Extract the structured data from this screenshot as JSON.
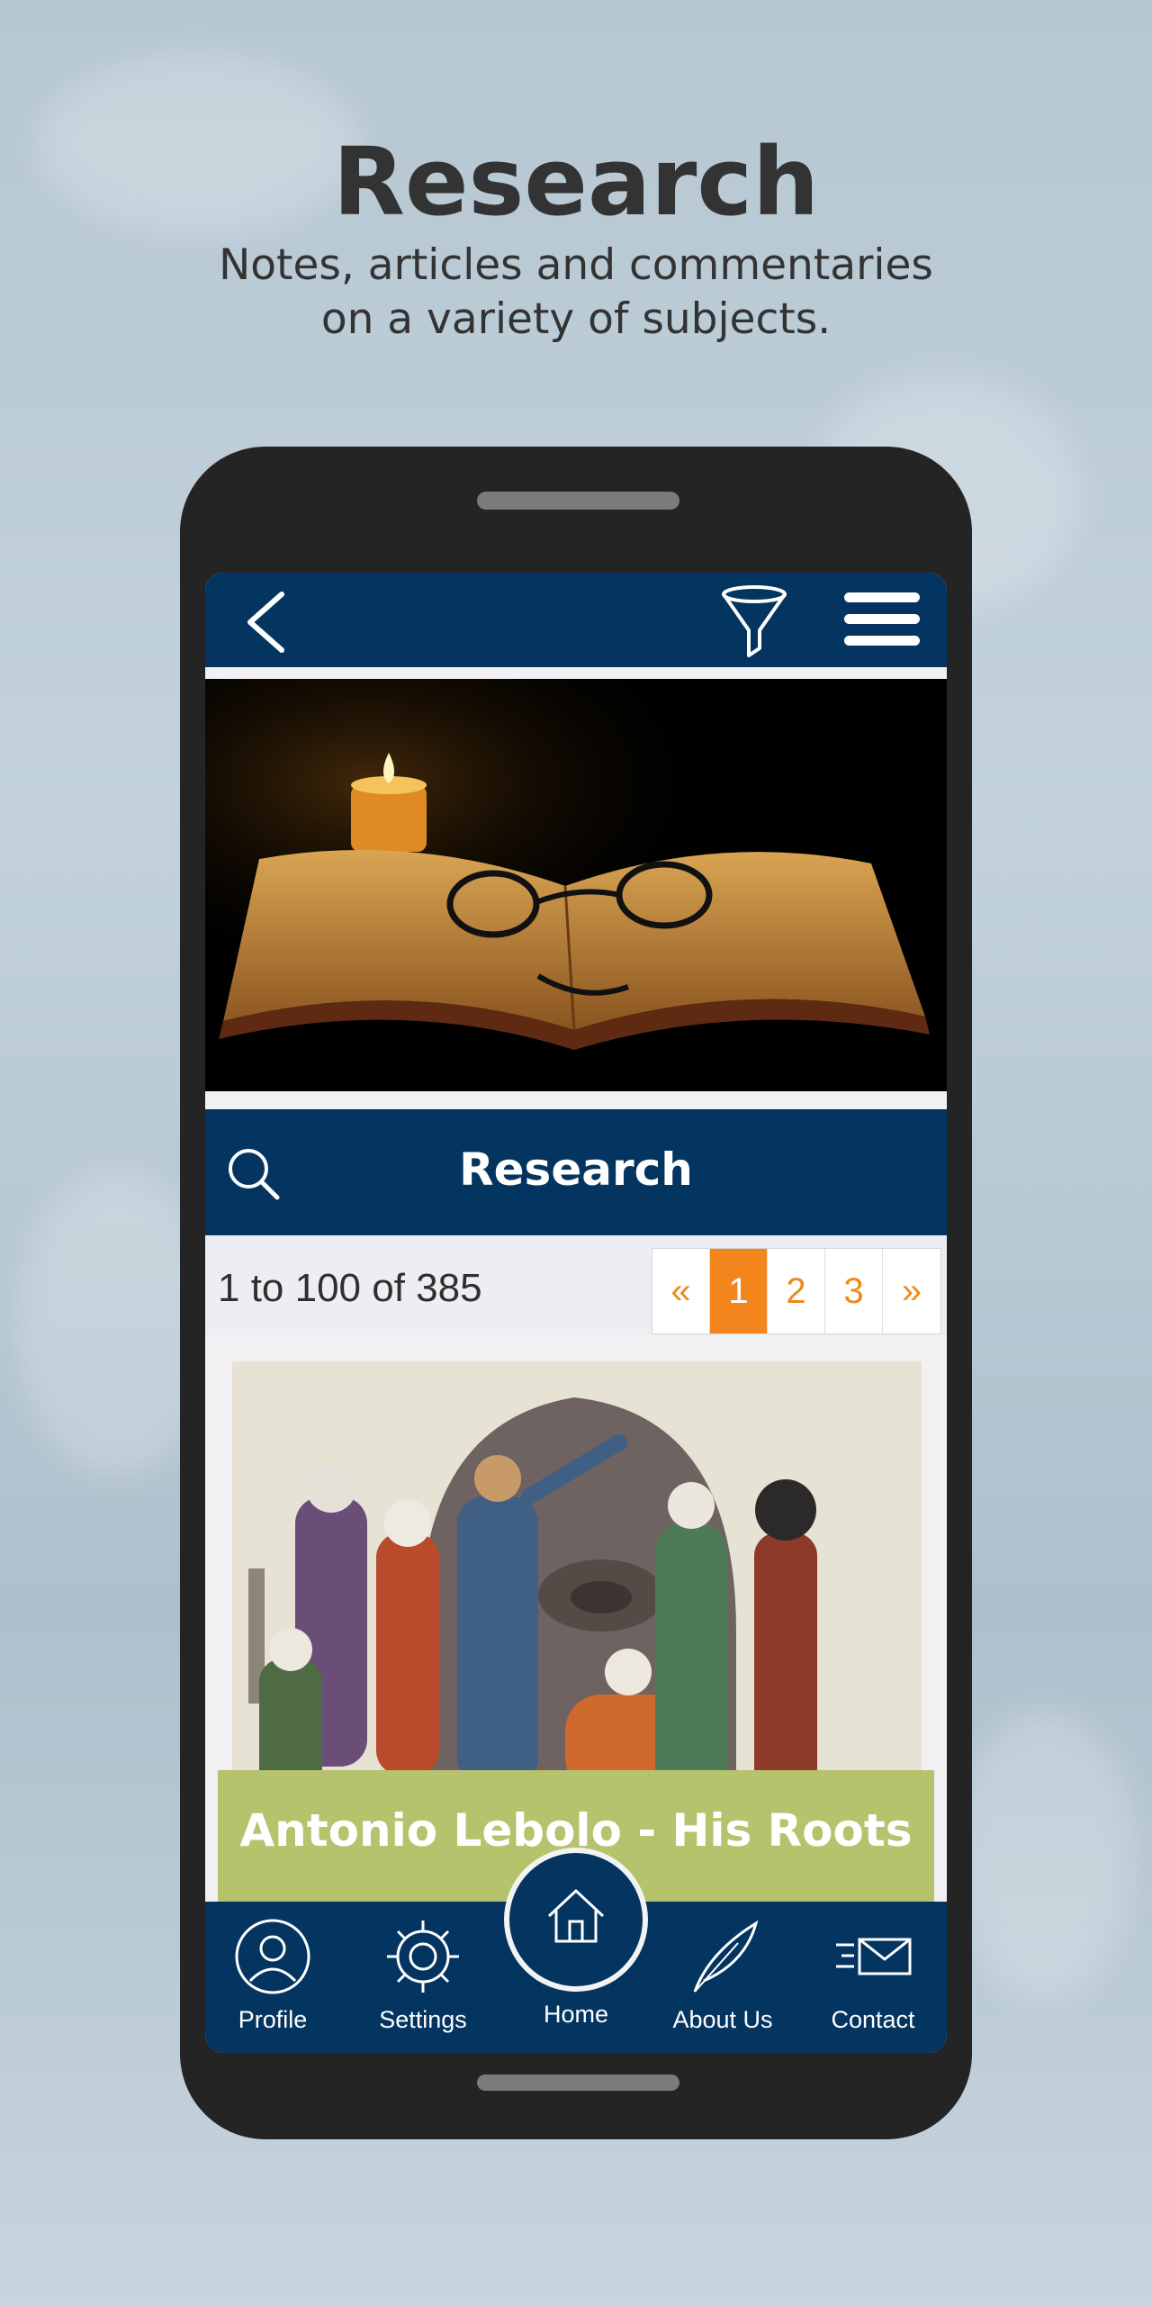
{
  "promo": {
    "headline": "Research",
    "subtitle_line1": "Notes, articles and commentaries",
    "subtitle_line2": "on a variety of subjects."
  },
  "app": {
    "topbar": {
      "back_icon": "back-chevron-icon",
      "filter_icon": "funnel-filter-icon",
      "menu_icon": "hamburger-menu-icon"
    },
    "hero_image": "candle-and-open-book-with-glasses",
    "title_bar": {
      "search_icon": "search-icon",
      "title": "Research"
    },
    "results": {
      "count_text": "1 to 100 of 385",
      "pager": {
        "prev": "«",
        "pages": [
          "1",
          "2",
          "3"
        ],
        "current": "1",
        "next": "»"
      }
    },
    "article_card": {
      "image": "illustration-of-travelers-before-egyptian-statue",
      "title": "Antonio Lebolo - His Roots"
    },
    "bottom_nav": [
      {
        "label": "Profile",
        "icon": "profile-icon"
      },
      {
        "label": "Settings",
        "icon": "gear-icon"
      },
      {
        "label": "Home",
        "icon": "home-icon"
      },
      {
        "label": "About Us",
        "icon": "feather-icon"
      },
      {
        "label": "Contact",
        "icon": "envelope-icon"
      }
    ]
  },
  "colors": {
    "navy": "#033560",
    "accent_orange": "#f2861d",
    "caption_green": "#b6c26c"
  }
}
